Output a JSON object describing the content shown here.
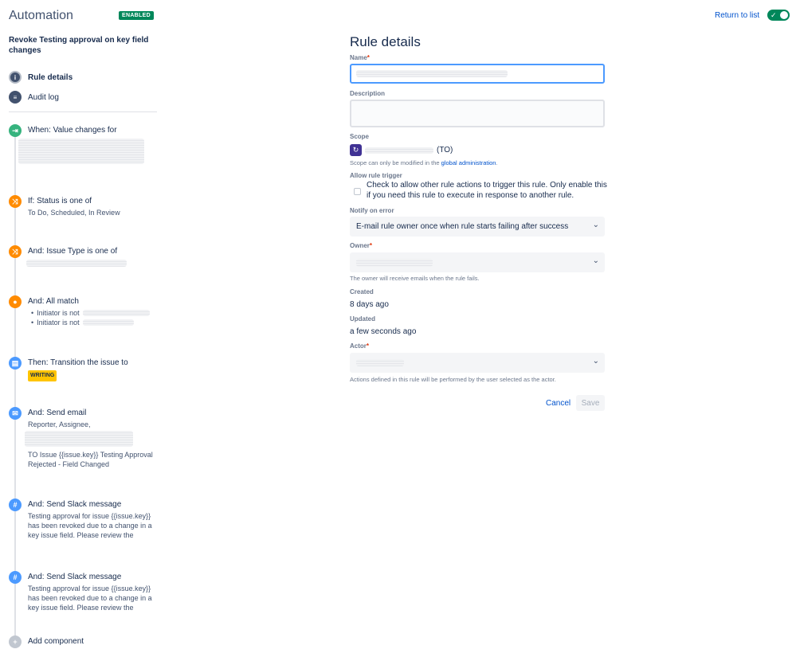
{
  "header": {
    "title": "Automation",
    "badge": "ENABLED",
    "return_link": "Return to list",
    "toggle_icon": "check-icon"
  },
  "rule": {
    "name": "Revoke Testing approval on key field changes"
  },
  "nav": {
    "rule_details": "Rule details",
    "audit_log": "Audit log"
  },
  "components": [
    {
      "title": "When: Value changes for",
      "icon": "trigger-icon",
      "color": "#36b37e"
    },
    {
      "title": "If: Status is one of",
      "desc": "To Do, Scheduled, In Review",
      "icon": "condition-icon",
      "color": "#ff8b00"
    },
    {
      "title": "And: Issue Type is one of",
      "icon": "condition-icon",
      "color": "#ff8b00"
    },
    {
      "title": "And: All match",
      "bullets": [
        "Initiator is not",
        "Initiator is not"
      ],
      "icon": "user-condition-icon",
      "color": "#ff8b00"
    },
    {
      "title": "Then: Transition the issue to",
      "lozenge": "WRITING",
      "icon": "transition-icon",
      "color": "#4c9aff"
    },
    {
      "title": "And: Send email",
      "desc1": "Reporter, Assignee,",
      "desc2": "TO Issue {{issue.key}} Testing Approval Rejected - Field Changed",
      "icon": "email-icon",
      "color": "#4c9aff"
    },
    {
      "title": "And: Send Slack message",
      "desc": "Testing approval for issue {{issue.key}} has been revoked due to a change in a key issue field. Please review the",
      "icon": "slack-icon",
      "color": "#4c9aff"
    },
    {
      "title": "And: Send Slack message",
      "desc": "Testing approval for issue {{issue.key}} has been revoked due to a change in a key issue field. Please review the",
      "icon": "slack-icon",
      "color": "#4c9aff"
    },
    {
      "title": "Add component",
      "icon": "add-icon",
      "color": "#c1c7d0"
    }
  ],
  "form": {
    "title": "Rule details",
    "name_label": "Name",
    "required_mark": "*",
    "description_label": "Description",
    "scope_label": "Scope",
    "scope_suffix": "(TO)",
    "scope_help_prefix": "Scope can only be modified in the ",
    "scope_help_link": "global administration",
    "scope_help_suffix": ".",
    "allow_trigger_label": "Allow rule trigger",
    "allow_trigger_text": "Check to allow other rule actions to trigger this rule. Only enable this if you need this rule to execute in response to another rule.",
    "notify_label": "Notify on error",
    "notify_value": "E-mail rule owner once when rule starts failing after success",
    "owner_label": "Owner",
    "owner_help": "The owner will receive emails when the rule fails.",
    "created_label": "Created",
    "created_value": "8 days ago",
    "updated_label": "Updated",
    "updated_value": "a few seconds ago",
    "actor_label": "Actor",
    "actor_help": "Actions defined in this rule will be performed by the user selected as the actor.",
    "cancel": "Cancel",
    "save": "Save"
  }
}
